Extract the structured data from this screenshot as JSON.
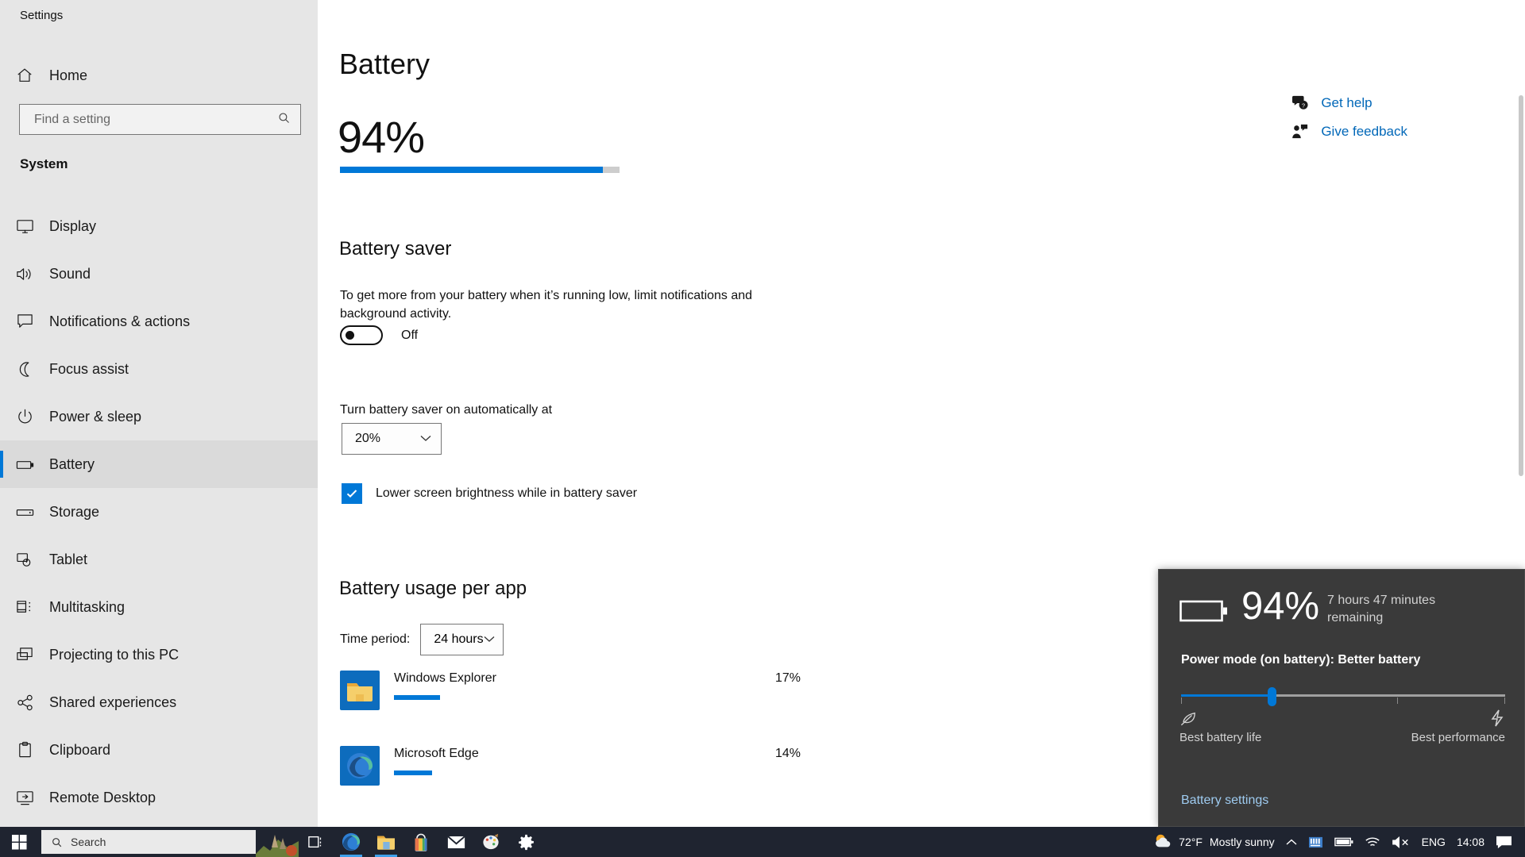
{
  "window": {
    "title": "Settings",
    "controls": {
      "minimize": "minimize-icon",
      "maximize": "maximize-icon",
      "close": "close-icon"
    }
  },
  "sidebar": {
    "home_label": "Home",
    "search": {
      "placeholder": "Find a setting",
      "value": "",
      "icon": "search-icon"
    },
    "section_header": "System",
    "items": [
      {
        "label": "Display",
        "icon": "monitor-icon",
        "selected": false
      },
      {
        "label": "Sound",
        "icon": "speaker-icon",
        "selected": false
      },
      {
        "label": "Notifications & actions",
        "icon": "comment-icon",
        "selected": false
      },
      {
        "label": "Focus assist",
        "icon": "moon-icon",
        "selected": false
      },
      {
        "label": "Power & sleep",
        "icon": "power-icon",
        "selected": false
      },
      {
        "label": "Battery",
        "icon": "battery-icon",
        "selected": true
      },
      {
        "label": "Storage",
        "icon": "drive-icon",
        "selected": false
      },
      {
        "label": "Tablet",
        "icon": "tablet-touch-icon",
        "selected": false
      },
      {
        "label": "Multitasking",
        "icon": "multitask-icon",
        "selected": false
      },
      {
        "label": "Projecting to this PC",
        "icon": "project-screen-icon",
        "selected": false
      },
      {
        "label": "Shared experiences",
        "icon": "share-icon",
        "selected": false
      },
      {
        "label": "Clipboard",
        "icon": "clipboard-icon",
        "selected": false
      },
      {
        "label": "Remote Desktop",
        "icon": "remote-desktop-icon",
        "selected": false
      }
    ]
  },
  "main": {
    "page_title": "Battery",
    "battery_percent_label": "94%",
    "battery_percent_value": 94,
    "help_links": [
      {
        "label": "Get help",
        "icon": "help-chat-icon"
      },
      {
        "label": "Give feedback",
        "icon": "feedback-person-icon"
      }
    ],
    "battery_saver": {
      "heading": "Battery saver",
      "description": "To get more from your battery when it’s running low, limit notifications and background activity.",
      "toggle_state": "Off",
      "toggle_on": false,
      "auto_label": "Turn battery saver on automatically at",
      "auto_threshold": "20%",
      "lower_brightness_label": "Lower screen brightness while in battery saver",
      "lower_brightness_checked": true
    },
    "usage": {
      "heading": "Battery usage per app",
      "time_period_label": "Time period:",
      "time_period_value": "24 hours",
      "apps": [
        {
          "name": "Windows Explorer",
          "percent_label": "17%",
          "percent": 17,
          "icon": "folder-app-icon"
        },
        {
          "name": "Microsoft Edge",
          "percent_label": "14%",
          "percent": 14,
          "icon": "edge-app-icon"
        }
      ]
    }
  },
  "flyout": {
    "battery_icon": "battery-full-icon",
    "percent_label": "94%",
    "remaining": "7 hours 47 minutes remaining",
    "power_mode_label": "Power mode (on battery): Better battery",
    "slider_position_percent": 28,
    "left_icon": "leaf-icon",
    "right_icon": "lightning-icon",
    "left_label": "Best battery life",
    "right_label": "Best performance",
    "settings_link": "Battery settings"
  },
  "taskbar": {
    "start_icon": "windows-start-icon",
    "search_placeholder": "Search",
    "search_icon": "search-icon",
    "buttons": [
      {
        "name": "task-view",
        "icon": "task-view-icon"
      },
      {
        "name": "microsoft-edge",
        "icon": "edge-icon"
      },
      {
        "name": "file-explorer",
        "icon": "folder-icon"
      },
      {
        "name": "microsoft-store",
        "icon": "store-icon"
      },
      {
        "name": "mail",
        "icon": "mail-icon"
      },
      {
        "name": "paint",
        "icon": "paint-icon"
      },
      {
        "name": "settings",
        "icon": "gear-icon"
      }
    ],
    "tray": {
      "weather_temp": "72°F",
      "weather_desc": "Mostly sunny",
      "weather_icon": "sun-cloud-icon",
      "chevron_icon": "chevron-up-icon",
      "icons": [
        "onedrive-icon",
        "battery-tray-icon",
        "wifi-icon",
        "volume-muted-icon"
      ],
      "language": "ENG",
      "clock": "14:08",
      "action_center_icon": "action-center-icon"
    }
  },
  "colors": {
    "accent": "#0078d7",
    "link": "#0067b8",
    "sidebar_bg": "#e6e6e6",
    "flyout_bg": "#3a3a3a",
    "taskbar_bg": "#1f2430"
  }
}
